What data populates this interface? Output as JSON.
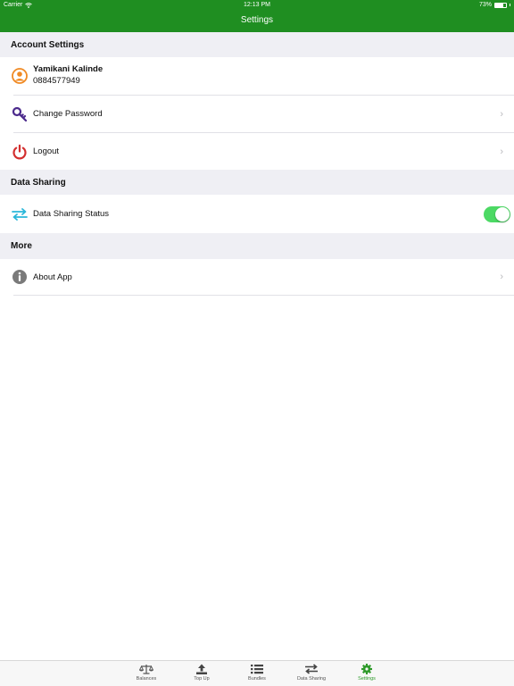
{
  "status_bar": {
    "carrier": "Carrier",
    "time": "12:13 PM",
    "battery": "73%",
    "battery_level": 0.73
  },
  "nav": {
    "title": "Settings"
  },
  "sections": {
    "account": {
      "header": "Account Settings",
      "user_name": "Yamikani Kalinde",
      "user_phone": "0884577949",
      "change_password": "Change Password",
      "logout": "Logout"
    },
    "data_sharing": {
      "header": "Data Sharing",
      "status_label": "Data Sharing Status",
      "status_on": true
    },
    "more": {
      "header": "More",
      "about": "About App"
    }
  },
  "tabs": [
    {
      "label": "Balances",
      "icon": "balance-scale-icon"
    },
    {
      "label": "Top Up",
      "icon": "upload-icon"
    },
    {
      "label": "Bundles",
      "icon": "list-icon"
    },
    {
      "label": "Data Sharing",
      "icon": "exchange-icon"
    },
    {
      "label": "Settings",
      "icon": "gear-icon"
    }
  ],
  "colors": {
    "brand_green": "#1f8e21",
    "toggle_green": "#4cd964",
    "active_tab": "#2e9a2a",
    "user_icon_orange": "#f08a24",
    "key_icon_purple": "#4b2a8c",
    "logout_red": "#d32f2f",
    "share_icon_blue": "#2bb7d9"
  }
}
